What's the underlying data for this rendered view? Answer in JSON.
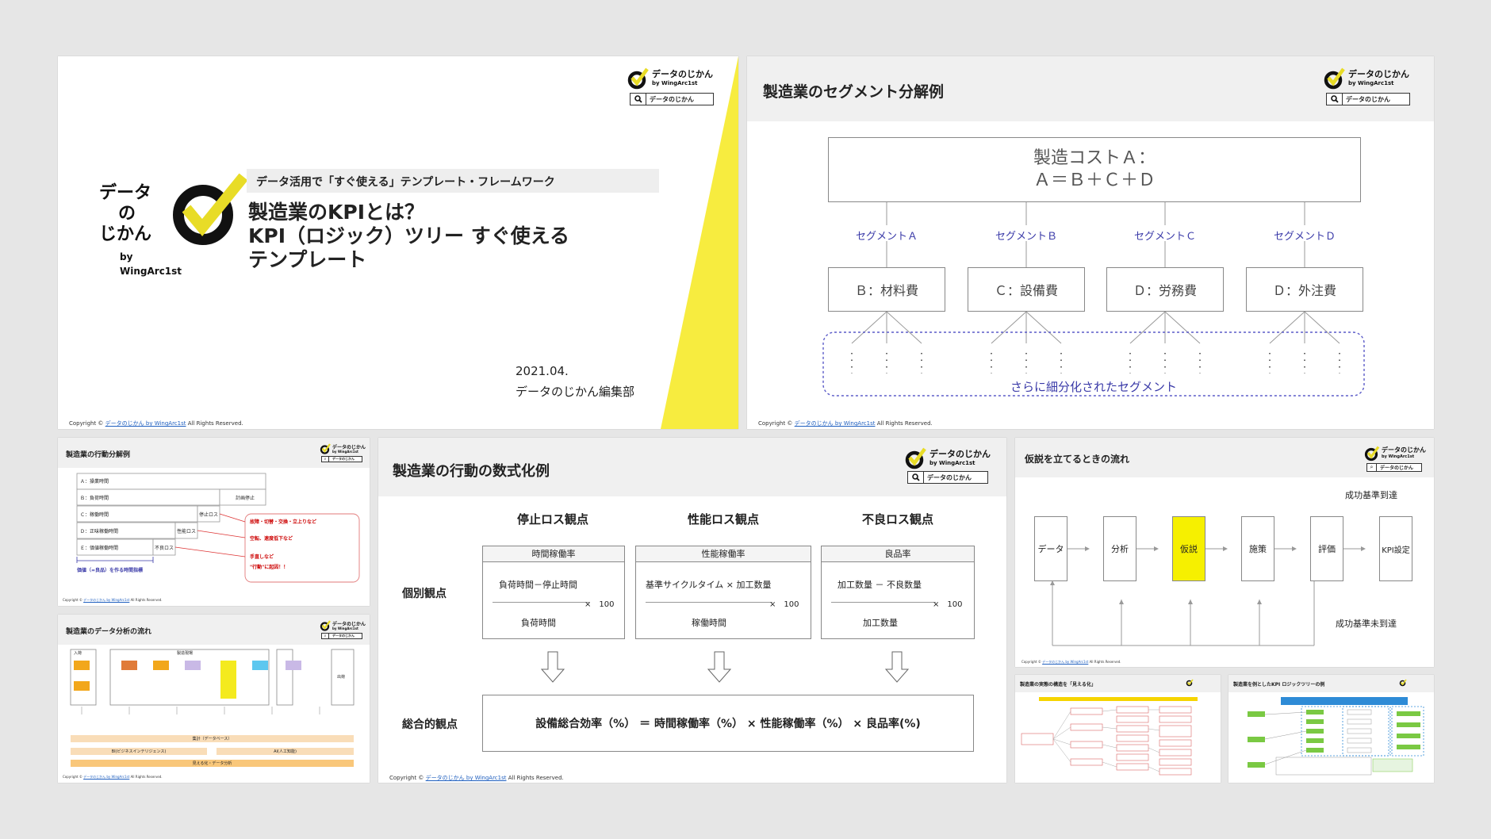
{
  "logo": {
    "name": "データのじかん",
    "by": "by WingArc1st",
    "search_label": "データのじかん"
  },
  "copyright": {
    "prefix": "Copyright © ",
    "link": "データのじかん by WingArc1st",
    "suffix": " All Rights Reserved."
  },
  "slide1": {
    "brand_line1": "データ",
    "brand_line2": "の",
    "brand_line3": "じかん",
    "brand_by": "by WingArc1st",
    "subtitle": "データ活用で「すぐ使える」テンプレート・フレームワーク",
    "title_line1": "製造業のKPIとは？",
    "title_line2": "KPI（ロジック）ツリー すぐ使える",
    "title_line3": "テンプレート",
    "date": "2021.04.",
    "editor": "データのじかん編集部"
  },
  "slide2": {
    "title": "製造業のセグメント分解例",
    "top_line1": "製造コストＡ：",
    "top_line2": "Ａ＝Ｂ＋Ｃ＋Ｄ",
    "segments": [
      {
        "label": "セグメントＡ",
        "box": "Ｂ：材料費"
      },
      {
        "label": "セグメントＢ",
        "box": "Ｃ：設備費"
      },
      {
        "label": "セグメントＣ",
        "box": "Ｄ：労務費"
      },
      {
        "label": "セグメントＤ",
        "box": "Ｄ：外注費"
      }
    ],
    "sub_label": "さらに細分化されたセグメント"
  },
  "slide3": {
    "title": "製造業の行動分解例",
    "rows": [
      "Ａ：操業時間",
      "Ｂ：負荷時間",
      "Ｃ：稼働時間",
      "Ｄ：正味稼働時間",
      "Ｅ：価値稼働時間"
    ],
    "right_labels": [
      "計画停止",
      "停止ロス",
      "性能ロス",
      "不良ロス"
    ],
    "notes": [
      "故障・切替・交換・立上りなど",
      "空転、速度低下など",
      "手直しなど",
      "\"行動\"に起因！！"
    ],
    "bottom_note": "価値（=良品）を作る時間指標"
  },
  "slide4": {
    "title": "製造業のデータ分析の流れ",
    "inbound": "入荷",
    "process": "製造現場",
    "shipping": "出荷",
    "db": "集計（データベース）",
    "bi": "BI(ビジネスインテリジェンス)",
    "ai": "AI(人工知能)",
    "viz": "見える化・データ分析"
  },
  "slide5": {
    "title": "製造業の行動の数式化例",
    "columns": [
      {
        "head": "停止ロス観点",
        "box_title": "時間稼働率",
        "numerator": "負荷時間－停止時間",
        "denominator": "負荷時間"
      },
      {
        "head": "性能ロス観点",
        "box_title": "性能稼働率",
        "numerator": "基準サイクルタイム × 加工数量",
        "denominator": "稼働時間"
      },
      {
        "head": "不良ロス観点",
        "box_title": "良品率",
        "numerator": "加工数量 － 不良数量",
        "denominator": "加工数量"
      }
    ],
    "times_100": "×　100",
    "row_individual": "個別観点",
    "row_total": "総合的観点",
    "formula": "設備総合効率（%） ＝ 時間稼働率（%） × 性能稼働率（%） × 良品率(%)"
  },
  "slide6": {
    "title": "仮説を立てるときの流れ",
    "steps": [
      "データ",
      "分析",
      "仮説",
      "施策",
      "評価",
      "KPI設定"
    ],
    "success": "成功基準到達",
    "fail": "成功基準未到達"
  },
  "slide7": {
    "title": "製造業の実態の構造を「見える化」"
  },
  "slide8": {
    "title": "製造業を例としたKPI ロジックツリーの例"
  }
}
